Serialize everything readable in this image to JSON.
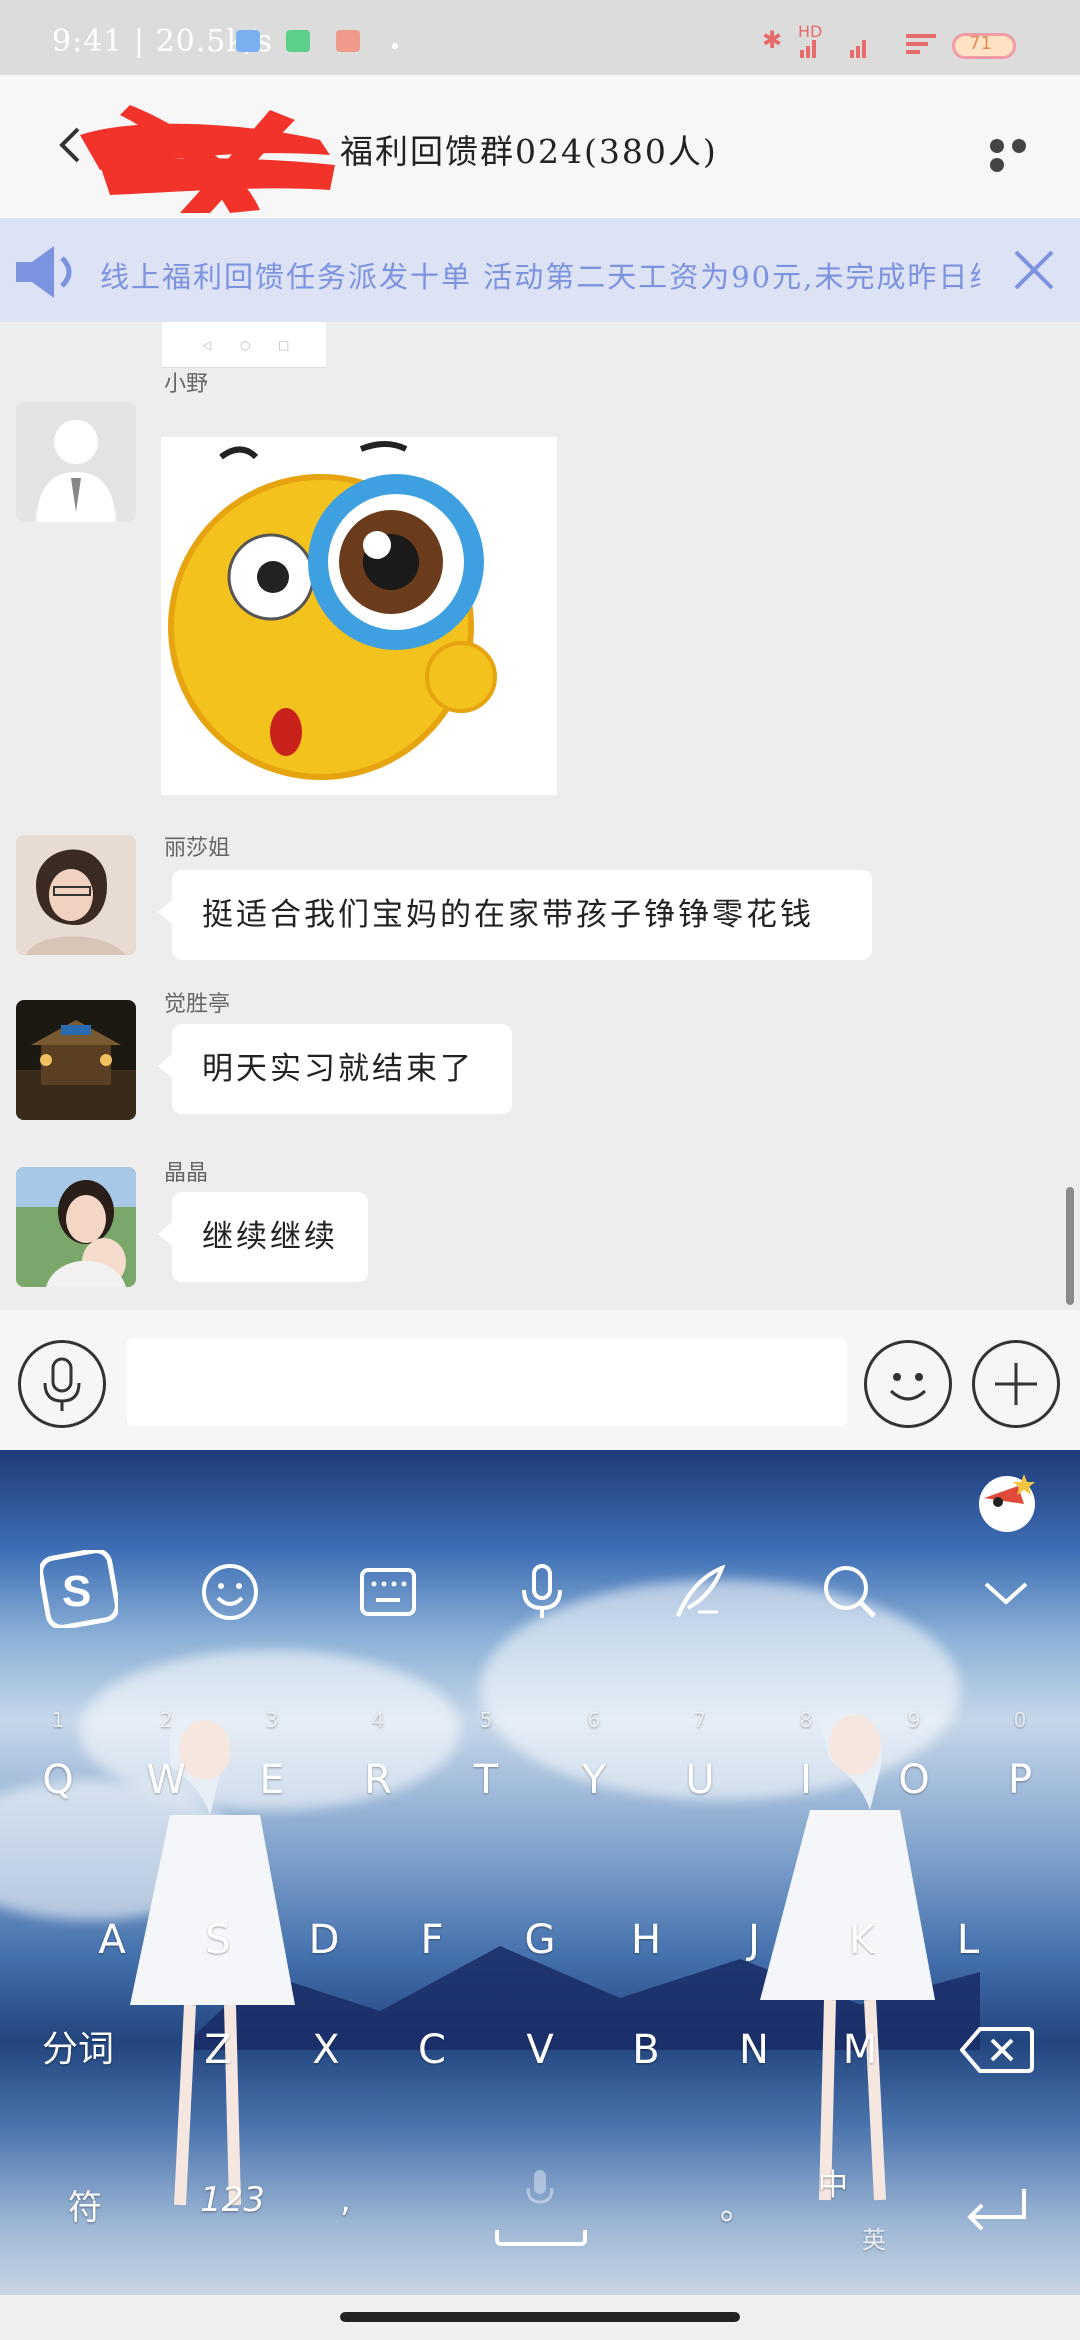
{
  "status_bar": {
    "time": "9:41",
    "speed": "20.5k/s",
    "network": "HD",
    "battery": "71"
  },
  "header": {
    "title": "福利回馈群024(380人)"
  },
  "notice": {
    "text": "线上福利回馈任务派发十单 活动第二天工资为90元,未完成昨日线..."
  },
  "messages": [
    {
      "sender": "小野",
      "type": "sticker"
    },
    {
      "sender": "丽莎姐",
      "type": "text",
      "text": "挺适合我们宝妈的在家带孩子铮铮零花钱"
    },
    {
      "sender": "觉胜亭",
      "type": "text",
      "text": "明天实习就结束了"
    },
    {
      "sender": "晶晶",
      "type": "text",
      "text": "继续继续"
    }
  ],
  "keyboard": {
    "row1": [
      {
        "k": "Q",
        "n": "1"
      },
      {
        "k": "W",
        "n": "2"
      },
      {
        "k": "E",
        "n": "3"
      },
      {
        "k": "R",
        "n": "4"
      },
      {
        "k": "T",
        "n": "5"
      },
      {
        "k": "Y",
        "n": "6"
      },
      {
        "k": "U",
        "n": "7"
      },
      {
        "k": "I",
        "n": "8"
      },
      {
        "k": "O",
        "n": "9"
      },
      {
        "k": "P",
        "n": "0"
      }
    ],
    "row2": [
      "A",
      "S",
      "D",
      "F",
      "G",
      "H",
      "J",
      "K",
      "L"
    ],
    "row3": [
      "Z",
      "X",
      "C",
      "V",
      "B",
      "N",
      "M"
    ],
    "segment_key": "分词",
    "symbol_key": "符",
    "num_key": "123",
    "comma": ",",
    "period": "。",
    "lang_zh": "中",
    "lang_en": "英"
  },
  "colors": {
    "notice_bg": "#dde2f4",
    "notice_text": "#7c93e0",
    "chat_bg": "#ededed",
    "redaction": "#f2332a"
  }
}
